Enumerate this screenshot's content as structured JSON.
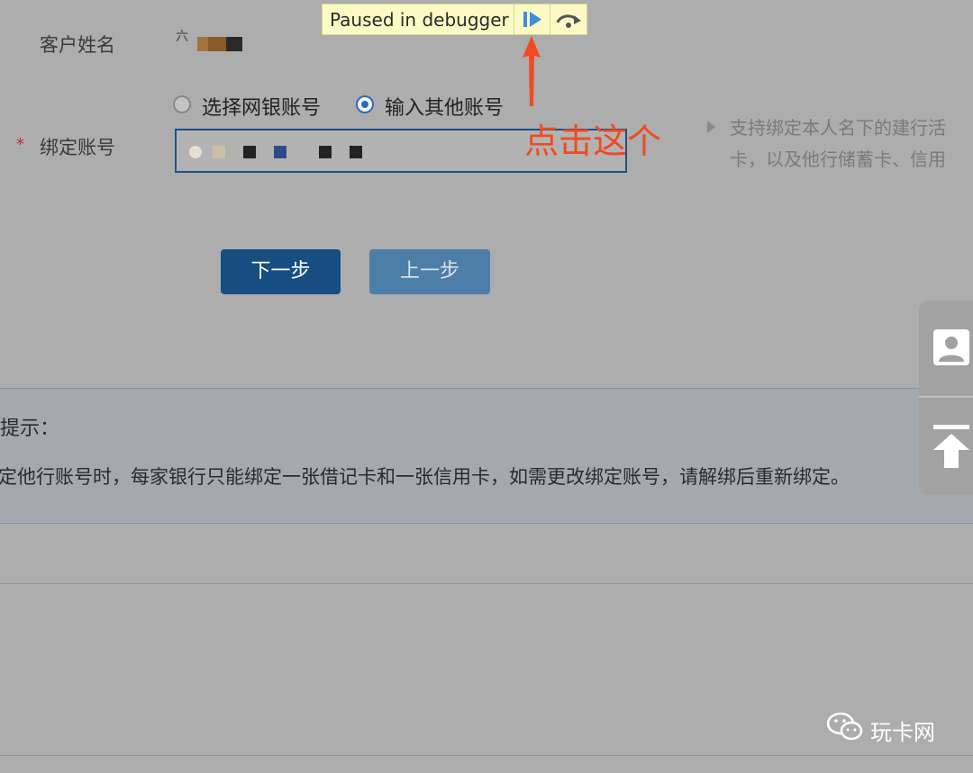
{
  "form": {
    "customer_name_label": "客户姓名",
    "customer_name_value_prefix": "六",
    "account_label": "绑定账号",
    "required_mark": "*",
    "radio_options": [
      {
        "label": "选择网银账号",
        "selected": false
      },
      {
        "label": "输入其他账号",
        "selected": true
      }
    ],
    "help_lines": [
      "支持绑定本人名下的建行活",
      "卡，以及他行储蓄卡、信用"
    ]
  },
  "buttons": {
    "next": "下一步",
    "prev": "上一步"
  },
  "tip": {
    "title": "提示：",
    "body": "定他行账号时，每家银行只能绑定一张借记卡和一张信用卡，如需更改绑定账号，请解绑后重新绑定。"
  },
  "debugger": {
    "status": "Paused in debugger",
    "resume_icon": "resume-icon",
    "step_over_icon": "step-over-icon",
    "background": "#fbfac4"
  },
  "annotation": {
    "text": "点击这个",
    "color": "#f04a20"
  },
  "watermark": {
    "text": "玩卡网"
  },
  "side_panel": {
    "contact_icon": "contact-card-icon",
    "top_icon": "back-to-top-icon"
  },
  "colors": {
    "primary_button": "#164e82",
    "secondary_button": "#4d7ea7",
    "input_border": "#1e4f86"
  }
}
